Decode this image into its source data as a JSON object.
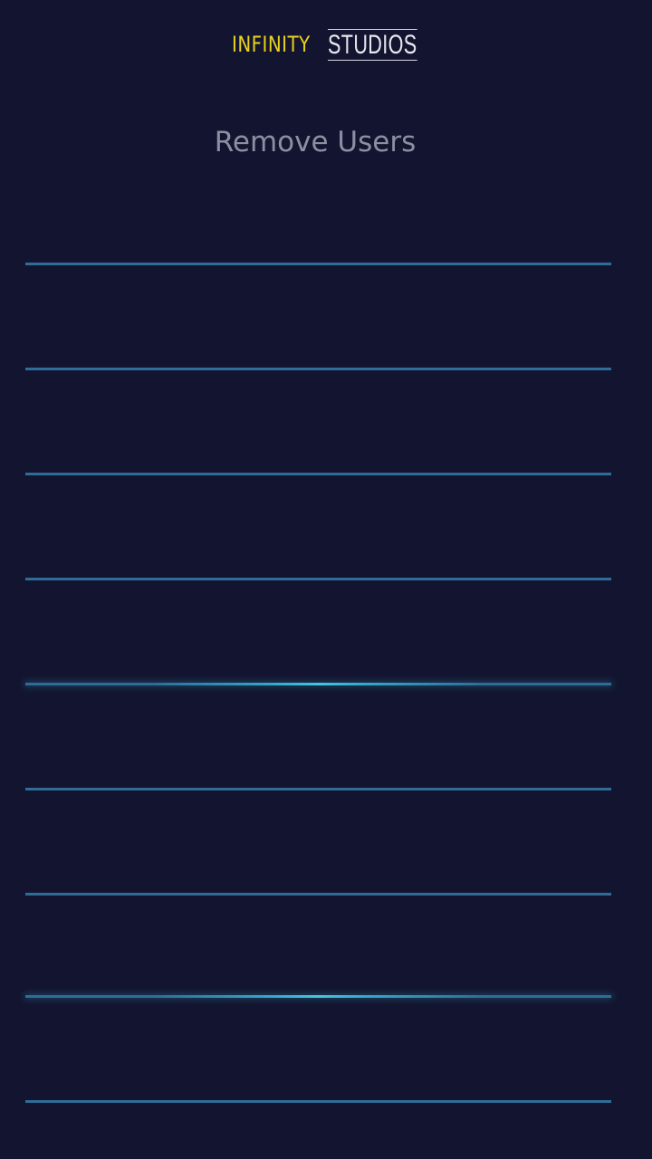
{
  "header": {
    "logo_word_1": "INFINITY",
    "logo_word_2": "STUDIOS"
  },
  "page": {
    "title": "Remove Users"
  },
  "user_list": {
    "items": [
      {
        "label": ""
      },
      {
        "label": ""
      },
      {
        "label": ""
      },
      {
        "label": ""
      },
      {
        "label": ""
      },
      {
        "label": ""
      },
      {
        "label": ""
      },
      {
        "label": ""
      },
      {
        "label": ""
      }
    ]
  },
  "colors": {
    "background": "#131530",
    "logo_accent": "#e9d21f",
    "logo_secondary": "#e8e8ef",
    "title_text": "#8c8fa1",
    "divider": "#2f6d98",
    "divider_glow": "#45c5de"
  }
}
